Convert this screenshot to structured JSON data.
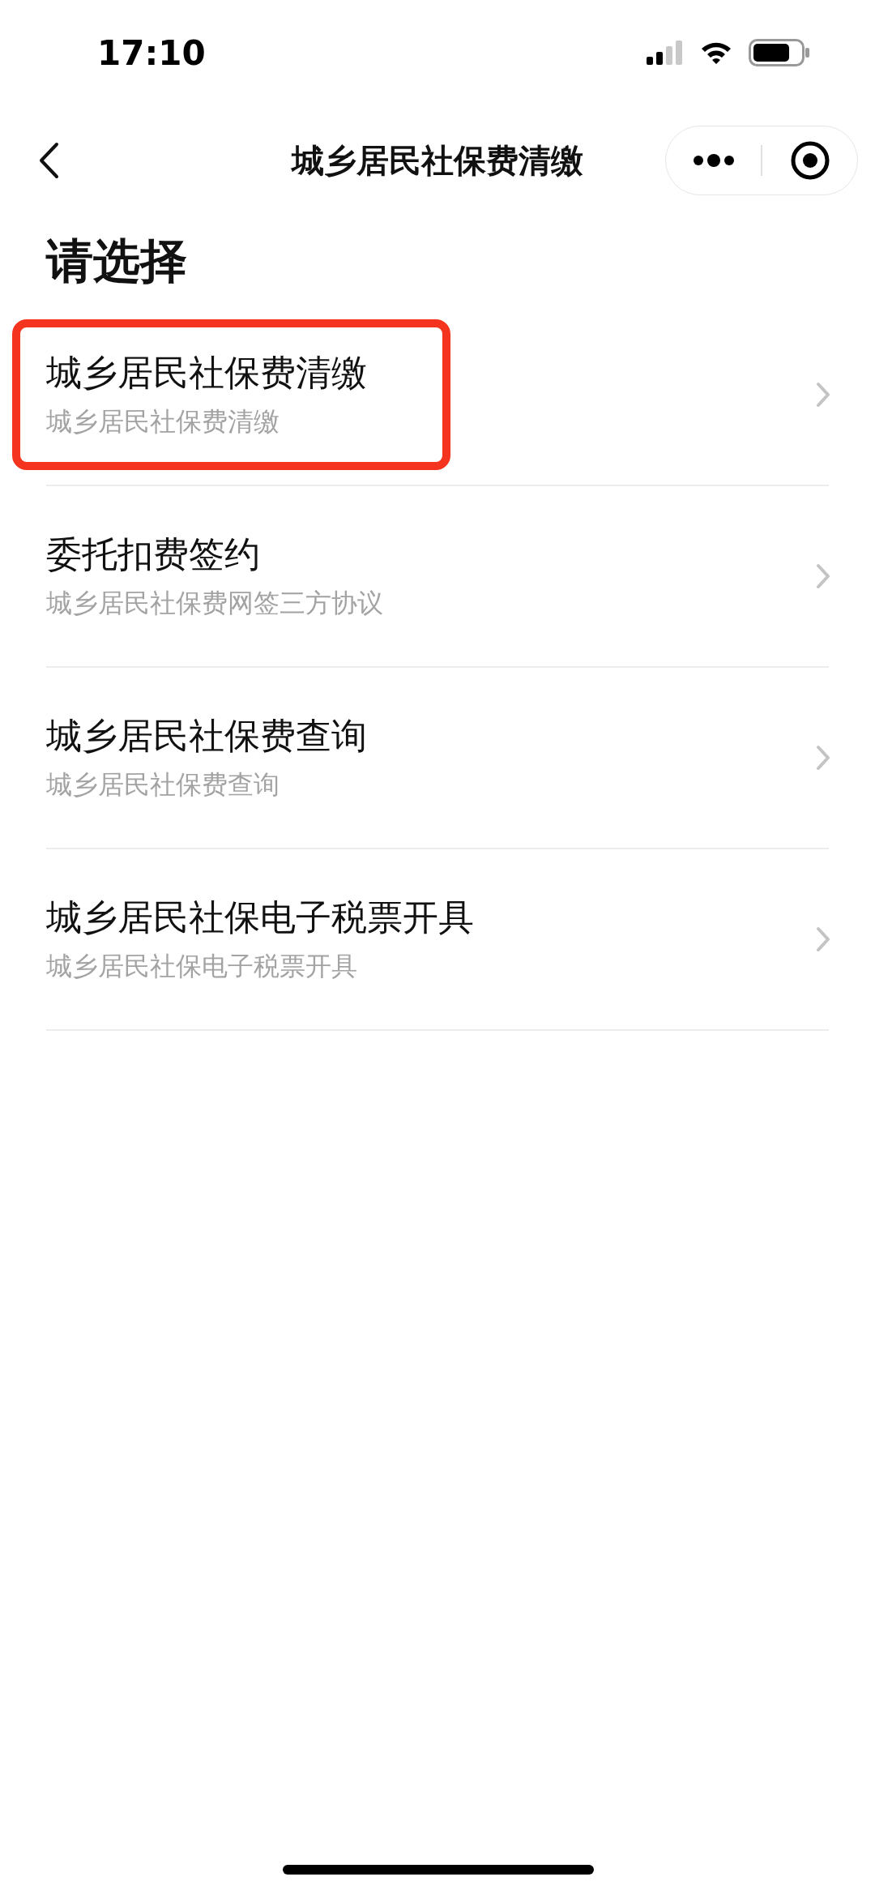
{
  "status_bar": {
    "time": "17:10"
  },
  "nav": {
    "title": "城乡居民社保费清缴"
  },
  "heading": "请选择",
  "items": [
    {
      "title": "城乡居民社保费清缴",
      "subtitle": "城乡居民社保费清缴",
      "highlighted": true
    },
    {
      "title": "委托扣费签约",
      "subtitle": "城乡居民社保费网签三方协议",
      "highlighted": false
    },
    {
      "title": "城乡居民社保费查询",
      "subtitle": "城乡居民社保费查询",
      "highlighted": false
    },
    {
      "title": "城乡居民社保电子税票开具",
      "subtitle": "城乡居民社保电子税票开具",
      "highlighted": false
    }
  ]
}
